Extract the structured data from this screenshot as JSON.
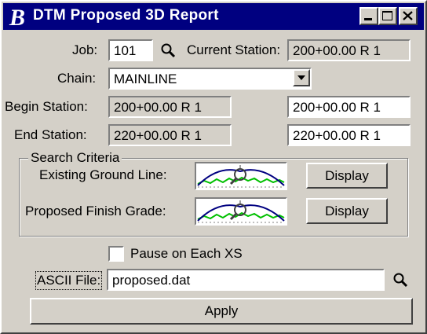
{
  "window": {
    "title": "DTM Proposed 3D Report"
  },
  "job": {
    "label": "Job:",
    "value": "101"
  },
  "current_station": {
    "label": "Current Station:",
    "value": "200+00.00 R 1"
  },
  "chain": {
    "label": "Chain:",
    "value": "MAINLINE"
  },
  "begin_station": {
    "label": "Begin Station:",
    "readonly_value": "200+00.00 R 1",
    "value": "200+00.00 R 1"
  },
  "end_station": {
    "label": "End Station:",
    "readonly_value": "220+00.00 R 1",
    "value": "220+00.00 R 1"
  },
  "search_criteria": {
    "group_label": "Search Criteria",
    "existing_ground": {
      "label": "Existing Ground Line:",
      "button": "Display"
    },
    "proposed_finish": {
      "label": "Proposed Finish Grade:",
      "button": "Display"
    }
  },
  "pause": {
    "label": "Pause on Each XS",
    "checked": false
  },
  "ascii_file": {
    "label": "ASCII File:",
    "value": "proposed.dat"
  },
  "apply": {
    "label": "Apply"
  },
  "icons": [
    "app-icon",
    "minimize-icon",
    "maximize-icon",
    "close-icon",
    "search-icon",
    "chevron-down-icon",
    "graph-preview-icon"
  ],
  "colors": {
    "titlebar": "#000080",
    "face": "#d4d0c8",
    "graph_green": "#00c000",
    "graph_blue": "#000080"
  }
}
